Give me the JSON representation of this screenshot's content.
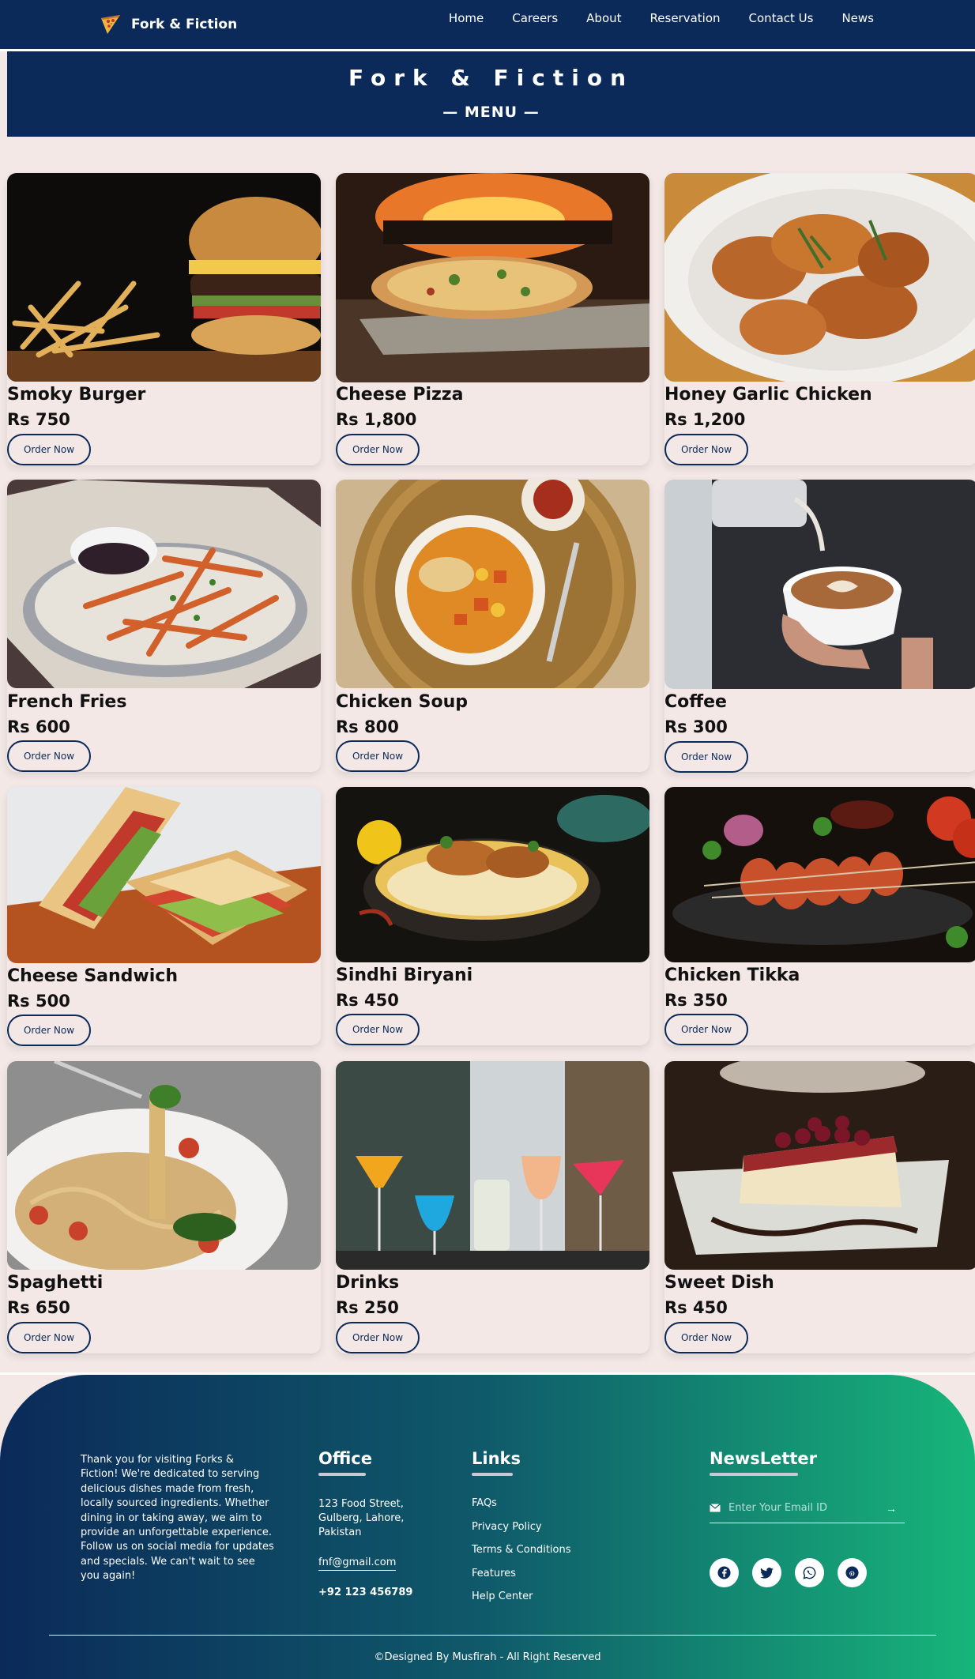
{
  "nav": {
    "brand": "Fork & Fiction",
    "brand_icon": "pizza-slice-icon",
    "links": [
      "Home",
      "Careers",
      "About",
      "Reservation",
      "Contact Us",
      "News"
    ]
  },
  "banner": {
    "title": "Fork & Fiction",
    "subtitle": "— MENU —"
  },
  "menu": {
    "order_label": "Order Now",
    "items": [
      {
        "name": "Smoky Burger",
        "price": "Rs 750",
        "image": "burger-with-fries"
      },
      {
        "name": "Cheese Pizza",
        "price": "Rs 1,800",
        "image": "pizza-by-oven"
      },
      {
        "name": "Honey Garlic Chicken",
        "price": "Rs 1,200",
        "image": "chicken-wings-plate"
      },
      {
        "name": "French Fries",
        "price": "Rs 600",
        "image": "fries-with-dip"
      },
      {
        "name": "Chicken Soup",
        "price": "Rs 800",
        "image": "soup-bowl"
      },
      {
        "name": "Coffee",
        "price": "Rs 300",
        "image": "latte-art-cup"
      },
      {
        "name": "Cheese Sandwich",
        "price": "Rs 500",
        "image": "club-sandwich"
      },
      {
        "name": "Sindhi Biryani",
        "price": "Rs 450",
        "image": "biryani-bowl"
      },
      {
        "name": "Chicken Tikka",
        "price": "Rs 350",
        "image": "tikka-skewers"
      },
      {
        "name": "Spaghetti",
        "price": "Rs 650",
        "image": "spaghetti-fork"
      },
      {
        "name": "Drinks",
        "price": "Rs 250",
        "image": "cocktail-glasses"
      },
      {
        "name": "Sweet Dish",
        "price": "Rs 450",
        "image": "cheesecake-slice"
      }
    ]
  },
  "footer": {
    "about": "Thank you for visiting Forks & Fiction! We're dedicated to serving delicious dishes made from fresh, locally sourced ingredients. Whether dining in or taking away, we aim to provide an unforgettable experience. Follow us on social media for updates and specials. We can't wait to see you again!",
    "office": {
      "title": "Office",
      "address": "123 Food Street, Gulberg, Lahore, Pakistan",
      "email": "fnf@gmail.com",
      "phone": "+92 123 456789"
    },
    "links": {
      "title": "Links",
      "items": [
        "FAQs",
        "Privacy Policy",
        "Terms & Conditions",
        "Features",
        "Help Center"
      ]
    },
    "newsletter": {
      "title": "NewsLetter",
      "placeholder": "Enter Your Email ID",
      "submit_icon": "arrow-right-icon",
      "mail_icon": "envelope-icon"
    },
    "socials": [
      "facebook-icon",
      "twitter-icon",
      "whatsapp-icon",
      "pinterest-icon"
    ],
    "copyright": "©Designed By Musfirah - All Right Reserved"
  },
  "colors": {
    "navy": "#0b2a59",
    "page_bg": "#f3e8e6",
    "footer_gradient_end": "#17b57a"
  }
}
